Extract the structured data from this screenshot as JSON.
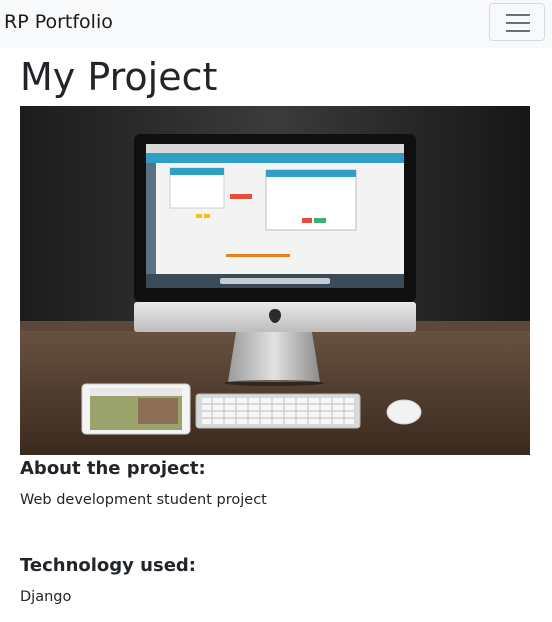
{
  "navbar": {
    "brand": "RP Portfolio",
    "toggler_icon": "hamburger-menu-icon"
  },
  "project": {
    "title": "My Project",
    "image_icon": "desk-setup-photo",
    "about_heading": "About the project:",
    "about_text": "Web development student project",
    "tech_heading": "Technology used:",
    "tech_text": "Django"
  },
  "colors": {
    "navbar_bg": "#f8f9fa",
    "text": "#212529"
  }
}
